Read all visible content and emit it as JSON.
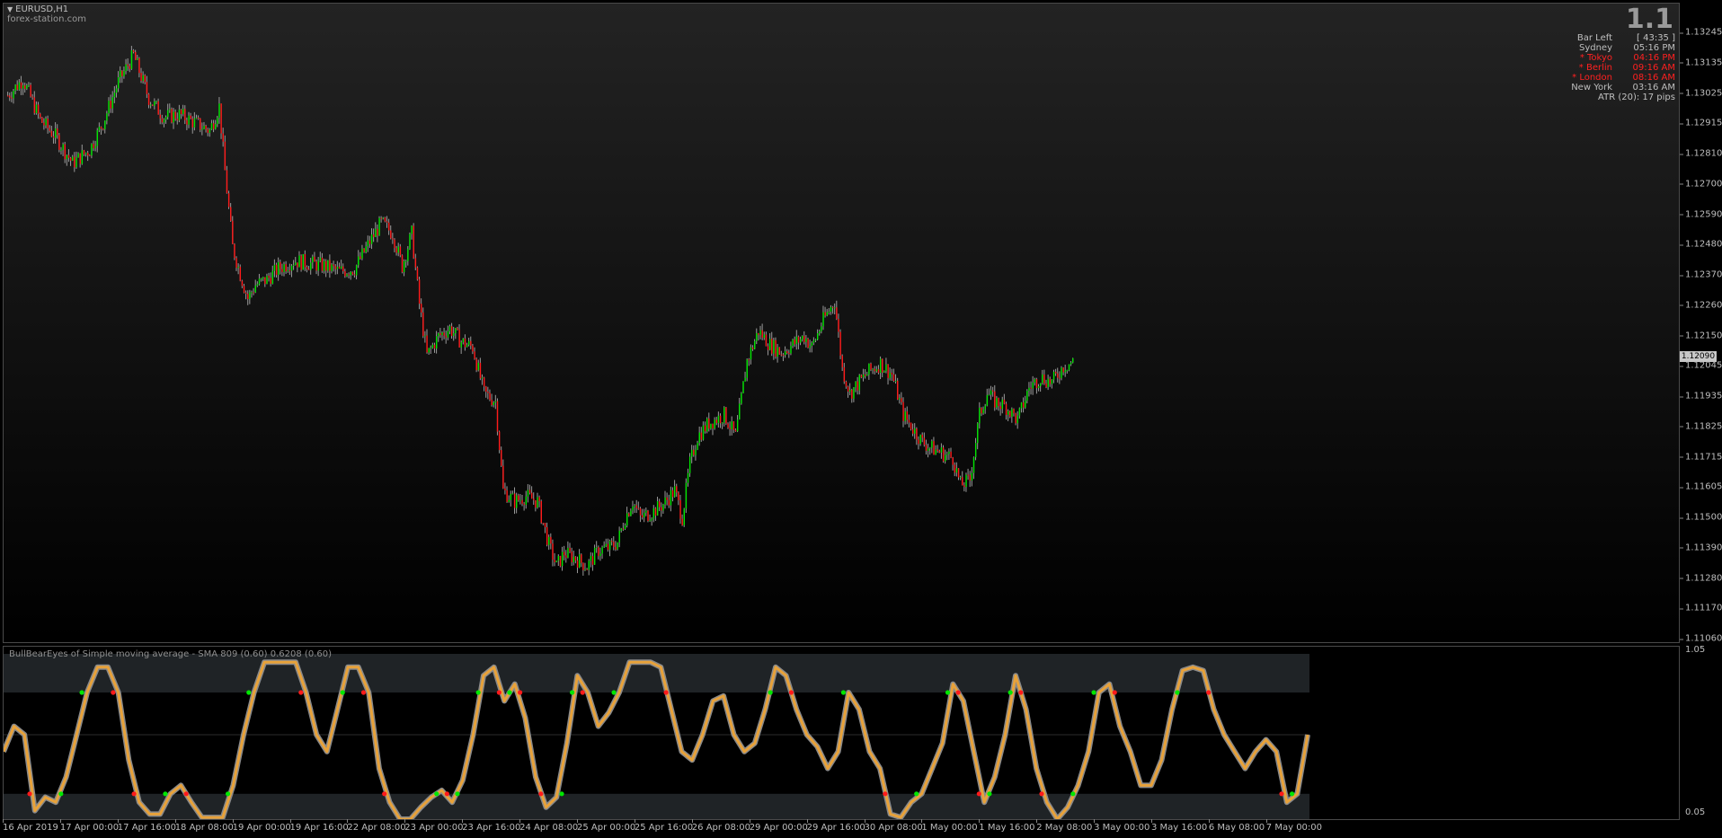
{
  "chart_header": {
    "symbol": "EURUSD,H1",
    "watermark": "forex-station.com",
    "spread": "1.1"
  },
  "info_panel": {
    "bar_left_label": "Bar Left",
    "bar_left_value": "[ 43:35 ]",
    "sessions": [
      {
        "name": "Sydney",
        "time": "05:16 PM",
        "open": false
      },
      {
        "name": "* Tokyo",
        "time": "04:16 PM",
        "open": true
      },
      {
        "name": "* Berlin",
        "time": "09:16 AM",
        "open": true
      },
      {
        "name": "* London",
        "time": "08:16 AM",
        "open": true
      },
      {
        "name": "New York",
        "time": "03:16 AM",
        "open": false
      }
    ],
    "atr": "ATR (20): 17 pips"
  },
  "colors": {
    "bull": "#00e600",
    "bear": "#ff1a1a",
    "wick": "#9a9a9a",
    "indicator_line": "#e8a23a",
    "indicator_outline": "#8a8a8a",
    "session_open": "#ff2020",
    "session_closed": "#bdbdbd",
    "zone": "#1f2326"
  },
  "price_axis": {
    "ticks": [
      "1.13245",
      "1.13135",
      "1.13025",
      "1.12915",
      "1.12810",
      "1.12700",
      "1.12590",
      "1.12480",
      "1.12370",
      "1.12260",
      "1.12150",
      "1.12045",
      "1.11935",
      "1.11825",
      "1.11715",
      "1.11605",
      "1.11500",
      "1.11390",
      "1.11280",
      "1.11170",
      "1.11060"
    ],
    "current_price": "1.12090"
  },
  "indicator": {
    "title": "BullBearEyes of Simple moving average - SMA 809 (0.60) 0.6208 (0.60)",
    "axis_ticks": [
      "1.05",
      "0.05"
    ]
  },
  "time_axis": {
    "ticks": [
      "16 Apr 2019",
      "17 Apr 00:00",
      "17 Apr 16:00",
      "18 Apr 08:00",
      "19 Apr 00:00",
      "19 Apr 16:00",
      "22 Apr 08:00",
      "23 Apr 00:00",
      "23 Apr 16:00",
      "24 Apr 08:00",
      "25 Apr 00:00",
      "25 Apr 16:00",
      "26 Apr 08:00",
      "29 Apr 00:00",
      "29 Apr 16:00",
      "30 Apr 08:00",
      "1 May 00:00",
      "1 May 16:00",
      "2 May 08:00",
      "3 May 00:00",
      "3 May 16:00",
      "6 May 08:00",
      "7 May 00:00"
    ]
  },
  "chart_data": [
    {
      "type": "candlestick",
      "title": "EURUSD,H1",
      "ylim": [
        1.1106,
        1.133
      ],
      "close_path": [
        [
          0,
          1.1306
        ],
        [
          8,
          1.1312
        ],
        [
          17,
          1.1297
        ],
        [
          25,
          1.1291
        ],
        [
          34,
          1.1281
        ],
        [
          43,
          1.1286
        ],
        [
          50,
          1.1296
        ],
        [
          58,
          1.1311
        ],
        [
          66,
          1.1321
        ],
        [
          74,
          1.1305
        ],
        [
          82,
          1.1298
        ],
        [
          90,
          1.1299
        ],
        [
          98,
          1.1296
        ],
        [
          106,
          1.1293
        ],
        [
          111,
          1.1302
        ],
        [
          114,
          1.1278
        ],
        [
          118,
          1.125
        ],
        [
          122,
          1.124
        ],
        [
          126,
          1.1231
        ],
        [
          130,
          1.1236
        ],
        [
          136,
          1.1238
        ],
        [
          142,
          1.1242
        ],
        [
          150,
          1.1245
        ],
        [
          158,
          1.1244
        ],
        [
          166,
          1.1243
        ],
        [
          174,
          1.1241
        ],
        [
          182,
          1.1242
        ],
        [
          190,
          1.1252
        ],
        [
          196,
          1.1259
        ],
        [
          202,
          1.1255
        ],
        [
          207,
          1.1243
        ],
        [
          212,
          1.1255
        ],
        [
          216,
          1.1229
        ],
        [
          220,
          1.121
        ],
        [
          226,
          1.1217
        ],
        [
          232,
          1.122
        ],
        [
          238,
          1.1215
        ],
        [
          244,
          1.1213
        ],
        [
          250,
          1.1196
        ],
        [
          256,
          1.1193
        ],
        [
          260,
          1.116
        ],
        [
          266,
          1.1156
        ],
        [
          272,
          1.1158
        ],
        [
          278,
          1.1156
        ],
        [
          284,
          1.114
        ],
        [
          288,
          1.1132
        ],
        [
          292,
          1.1137
        ],
        [
          298,
          1.1135
        ],
        [
          304,
          1.1132
        ],
        [
          310,
          1.1138
        ],
        [
          316,
          1.1139
        ],
        [
          320,
          1.1141
        ],
        [
          324,
          1.115
        ],
        [
          328,
          1.1156
        ],
        [
          332,
          1.115
        ],
        [
          338,
          1.1152
        ],
        [
          344,
          1.1155
        ],
        [
          350,
          1.116
        ],
        [
          354,
          1.115
        ],
        [
          358,
          1.117
        ],
        [
          362,
          1.118
        ],
        [
          368,
          1.1185
        ],
        [
          376,
          1.1188
        ],
        [
          382,
          1.118
        ],
        [
          388,
          1.1208
        ],
        [
          394,
          1.1219
        ],
        [
          400,
          1.1214
        ],
        [
          406,
          1.1211
        ],
        [
          412,
          1.1214
        ],
        [
          418,
          1.1217
        ],
        [
          422,
          1.1213
        ],
        [
          428,
          1.1223
        ],
        [
          434,
          1.123
        ],
        [
          438,
          1.1205
        ],
        [
          442,
          1.1196
        ],
        [
          448,
          1.1201
        ],
        [
          452,
          1.1204
        ],
        [
          458,
          1.1207
        ],
        [
          464,
          1.1203
        ],
        [
          470,
          1.1188
        ],
        [
          476,
          1.1182
        ],
        [
          480,
          1.1178
        ],
        [
          484,
          1.1176
        ],
        [
          490,
          1.1174
        ],
        [
          496,
          1.1172
        ],
        [
          500,
          1.1162
        ],
        [
          505,
          1.1164
        ],
        [
          510,
          1.1188
        ],
        [
          514,
          1.1196
        ],
        [
          518,
          1.1193
        ],
        [
          524,
          1.1191
        ],
        [
          530,
          1.1186
        ],
        [
          536,
          1.1198
        ],
        [
          542,
          1.1202
        ],
        [
          548,
          1.12
        ],
        [
          554,
          1.1206
        ],
        [
          560,
          1.1208
        ]
      ]
    },
    {
      "type": "line",
      "title": "BullBearEyes of Simple moving average - SMA 809 (0.60) 0.6208 (0.60)",
      "ylim": [
        0.05,
        1.05
      ],
      "y": [
        0.45,
        0.6,
        0.55,
        0.1,
        0.18,
        0.15,
        0.3,
        0.55,
        0.8,
        0.95,
        0.95,
        0.8,
        0.4,
        0.15,
        0.08,
        0.08,
        0.2,
        0.25,
        0.15,
        0.06,
        0.06,
        0.06,
        0.25,
        0.55,
        0.8,
        0.98,
        0.98,
        0.98,
        0.98,
        0.8,
        0.55,
        0.45,
        0.7,
        0.95,
        0.95,
        0.8,
        0.35,
        0.15,
        0.05,
        0.05,
        0.12,
        0.18,
        0.22,
        0.15,
        0.28,
        0.55,
        0.9,
        0.95,
        0.75,
        0.85,
        0.65,
        0.3,
        0.12,
        0.18,
        0.5,
        0.9,
        0.8,
        0.6,
        0.68,
        0.8,
        0.98,
        0.98,
        0.98,
        0.95,
        0.7,
        0.45,
        0.4,
        0.55,
        0.75,
        0.78,
        0.55,
        0.45,
        0.5,
        0.7,
        0.95,
        0.9,
        0.7,
        0.55,
        0.48,
        0.35,
        0.45,
        0.8,
        0.7,
        0.45,
        0.35,
        0.08,
        0.06,
        0.15,
        0.2,
        0.35,
        0.5,
        0.85,
        0.75,
        0.45,
        0.15,
        0.3,
        0.55,
        0.9,
        0.7,
        0.35,
        0.15,
        0.05,
        0.12,
        0.25,
        0.45,
        0.8,
        0.85,
        0.6,
        0.45,
        0.25,
        0.25,
        0.4,
        0.7,
        0.93,
        0.95,
        0.93,
        0.7,
        0.55,
        0.45,
        0.35,
        0.45,
        0.52,
        0.45,
        0.15,
        0.2,
        0.55
      ]
    }
  ]
}
